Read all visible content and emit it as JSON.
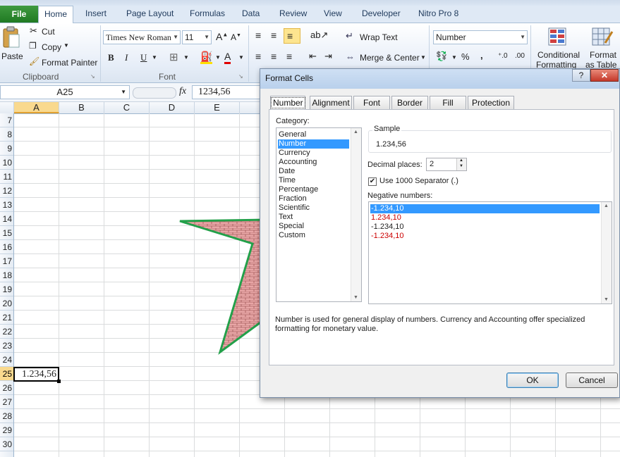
{
  "ribbon": {
    "tabs": [
      "File",
      "Home",
      "Insert",
      "Page Layout",
      "Formulas",
      "Data",
      "Review",
      "View",
      "Developer",
      "Nitro Pro 8"
    ],
    "clipboard": {
      "paste": "Paste",
      "cut": "Cut",
      "copy": "Copy",
      "format_painter": "Format Painter",
      "group": "Clipboard"
    },
    "font": {
      "name": "Times New Roman",
      "size": "11",
      "group": "Font",
      "bold": "B",
      "italic": "I",
      "underline": "U"
    },
    "alignment": {
      "wrap_text": "Wrap Text",
      "merge_center": "Merge & Center"
    },
    "number": {
      "format": "Number",
      "percent": "%",
      "comma": ","
    },
    "styles": {
      "conditional": "Conditional",
      "conditional2": "Formatting",
      "format_as": "Format",
      "format_as2": "as Table"
    }
  },
  "formula_bar": {
    "name_box": "A25",
    "fx": "fx",
    "value": "1234,56"
  },
  "sheet": {
    "columns": [
      "A",
      "B",
      "C",
      "D",
      "E"
    ],
    "rows": [
      "7",
      "8",
      "9",
      "10",
      "11",
      "12",
      "13",
      "14",
      "15",
      "16",
      "17",
      "18",
      "19",
      "20",
      "21",
      "22",
      "23",
      "24",
      "25",
      "26",
      "27",
      "28",
      "29",
      "30"
    ],
    "active_cell_value": "1.234,56"
  },
  "dialog": {
    "title": "Format Cells",
    "help": "?",
    "close": "✕",
    "tabs": [
      "Number",
      "Alignment",
      "Font",
      "Border",
      "Fill",
      "Protection"
    ],
    "category_label": "Category:",
    "categories": [
      "General",
      "Number",
      "Currency",
      "Accounting",
      "Date",
      "Time",
      "Percentage",
      "Fraction",
      "Scientific",
      "Text",
      "Special",
      "Custom"
    ],
    "selected_category": "Number",
    "sample_label": "Sample",
    "sample_value": "1.234,56",
    "decimal_label": "Decimal places:",
    "decimal_value": "2",
    "separator_label": "Use 1000 Separator (.)",
    "separator_checked": true,
    "negative_label": "Negative numbers:",
    "negative_options": [
      {
        "text": "-1.234,10",
        "color": "#000000",
        "selected": true
      },
      {
        "text": "1.234,10",
        "color": "#cc0000",
        "selected": false
      },
      {
        "text": "-1.234,10",
        "color": "#000000",
        "selected": false
      },
      {
        "text": "-1.234,10",
        "color": "#cc0000",
        "selected": false
      }
    ],
    "description": "Number is used for general display of numbers.  Currency and Accounting offer specialized formatting for monetary value.",
    "ok": "OK",
    "cancel": "Cancel"
  },
  "colors": {
    "selection": "#3399ff",
    "star_outline": "#23a04a",
    "star_fill": "#e8a0a0"
  }
}
